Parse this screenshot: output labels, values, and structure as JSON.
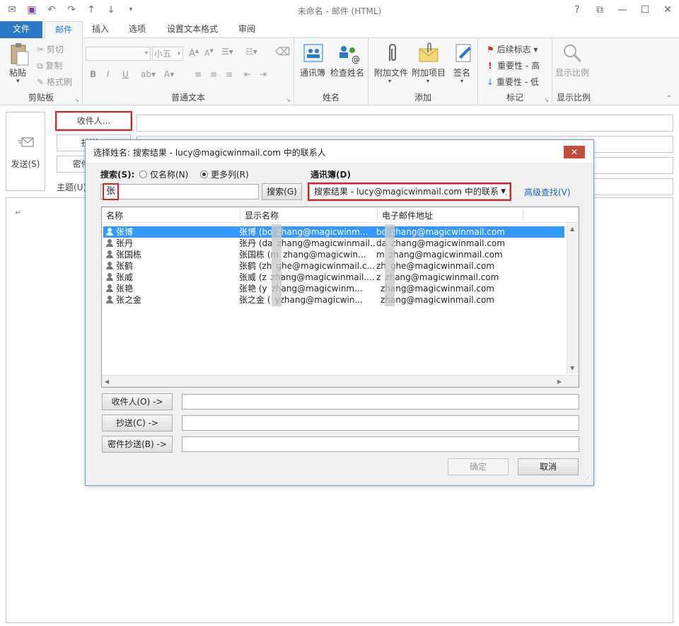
{
  "window": {
    "title": "未命名 - 邮件 (HTML)",
    "controls": [
      "?",
      "⧉",
      "—",
      "☐",
      "✕"
    ]
  },
  "tabs": [
    {
      "label": "文件"
    },
    {
      "label": "邮件"
    },
    {
      "label": "插入"
    },
    {
      "label": "选项"
    },
    {
      "label": "设置文本格式"
    },
    {
      "label": "审阅"
    }
  ],
  "ribbon": {
    "clipboard": {
      "label": "剪贴板",
      "paste": "粘贴",
      "cut": "剪切",
      "copy": "复制",
      "format_painter": "格式刷"
    },
    "basic_text": {
      "label": "普通文本",
      "font_size": "小五",
      "bold": "B",
      "italic": "I",
      "underline": "U"
    },
    "names": {
      "label": "姓名",
      "address_book": "通讯簿",
      "check_names": "检查姓名"
    },
    "include": {
      "label": "添加",
      "attach_file": "附加文件",
      "attach_item": "附加项目",
      "signature": "签名"
    },
    "tags": {
      "label": "标记",
      "follow_up": "后续标志",
      "high_importance": "重要性 - 高",
      "low_importance": "重要性 - 低"
    },
    "zoom": {
      "label": "显示比例",
      "zoom": "显示比例"
    }
  },
  "compose": {
    "send": "发送(S)",
    "to_button": "收件人...",
    "cc_button": "抄送...",
    "bcc_button": "密件抄送...",
    "subject_label": "主题(U)",
    "para_mark": "↵"
  },
  "dialog": {
    "title": "选择姓名: 搜索结果 - lucy@magicwinmail.com 中的联系人",
    "close": "✕",
    "search_label": "搜索(S):",
    "radio_name_only": "仅名称(N)",
    "radio_more_columns": "更多列(R)",
    "search_value": "张",
    "search_button": "搜索(G)",
    "address_book_label": "通讯簿(D)",
    "address_book_value": "搜索结果 - lucy@magicwinmail.com 中的联系人",
    "advanced_find": "高级查找(V)",
    "columns": [
      "名称",
      "显示名称",
      "电子邮件地址"
    ],
    "rows": [
      {
        "name": "张博",
        "display": "张博 (bo zhang@magicwinm...",
        "email": "bo zhang@magicwinmail.com",
        "selected": true
      },
      {
        "name": "张丹",
        "display": "张丹 (da zhang@magicwinmail....",
        "email": "da zhang@magicwinmail.com",
        "selected": false
      },
      {
        "name": "张国栋",
        "display": "张国栋 (m zhang@magicwin...",
        "email": "m zhang@magicwinmail.com",
        "selected": false
      },
      {
        "name": "张鹤",
        "display": "张鹤 (zh ghe@magicwinmail.c...",
        "email": "zh ghe@magicwinmail.com",
        "selected": false
      },
      {
        "name": "张威",
        "display": "张威 (z zhang@magicwinmail....",
        "email": "z zhang@magicwinmail.com",
        "selected": false
      },
      {
        "name": "张艳",
        "display": "张艳 (y zhang@magicwinm...",
        "email": " zhang@magicwinmail.com",
        "selected": false
      },
      {
        "name": "张之金",
        "display": "张之金 ( yzhang@magicwin...",
        "email": " zhang@magicwinmail.com",
        "selected": false
      }
    ],
    "to_button": "收件人(O) ->",
    "cc_button": "抄送(C) ->",
    "bcc_button": "密件抄送(B) ->",
    "ok": "确定",
    "cancel": "取消"
  },
  "colors": {
    "accent": "#2b78c5",
    "selection": "#3399ff",
    "highlight": "#e02020"
  }
}
